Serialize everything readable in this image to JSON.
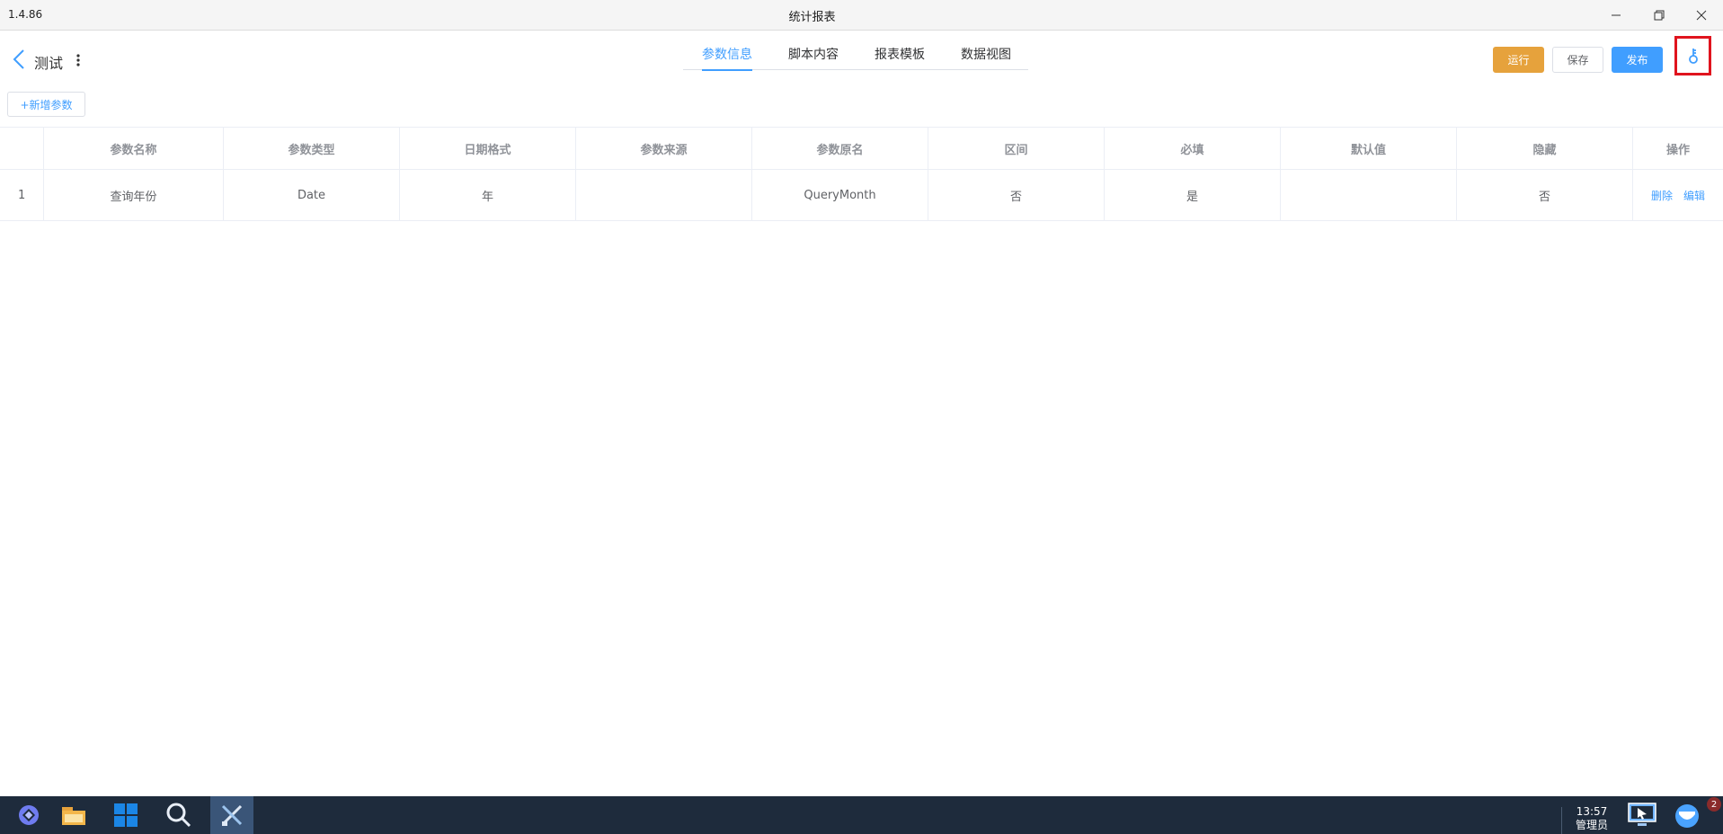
{
  "window": {
    "version": "1.4.86",
    "title": "统计报表"
  },
  "header": {
    "doc_name": "测试",
    "tabs": [
      {
        "label": "参数信息",
        "active": true
      },
      {
        "label": "脚本内容",
        "active": false
      },
      {
        "label": "报表模板",
        "active": false
      },
      {
        "label": "数据视图",
        "active": false
      }
    ],
    "buttons": {
      "run": "运行",
      "save": "保存",
      "publish": "发布"
    }
  },
  "toolbar": {
    "add_param": "+新增参数"
  },
  "table": {
    "columns": [
      "",
      "参数名称",
      "参数类型",
      "日期格式",
      "参数来源",
      "参数原名",
      "区间",
      "必填",
      "默认值",
      "隐藏",
      "操作"
    ],
    "rows": [
      {
        "index": "1",
        "name": "查询年份",
        "type": "Date",
        "date_format": "年",
        "source": "",
        "original_name": "QueryMonth",
        "range": "否",
        "required": "是",
        "default": "",
        "hidden": "否",
        "actions": {
          "delete": "删除",
          "edit": "编辑"
        }
      }
    ]
  },
  "taskbar": {
    "time": "13:57",
    "user": "管理员",
    "notification_count": "2"
  },
  "colors": {
    "accent": "#409eff",
    "run": "#e6a23c",
    "highlight_box": "#e0141e",
    "taskbar": "#1e2b3c"
  },
  "icons": [
    "back-arrow-icon",
    "more-vertical-icon",
    "key-icon",
    "minimize-icon",
    "restore-icon",
    "close-icon",
    "app-launcher-icon",
    "folder-icon",
    "start-grid-icon",
    "search-icon",
    "design-tool-icon",
    "screen-share-icon",
    "chat-icon"
  ]
}
